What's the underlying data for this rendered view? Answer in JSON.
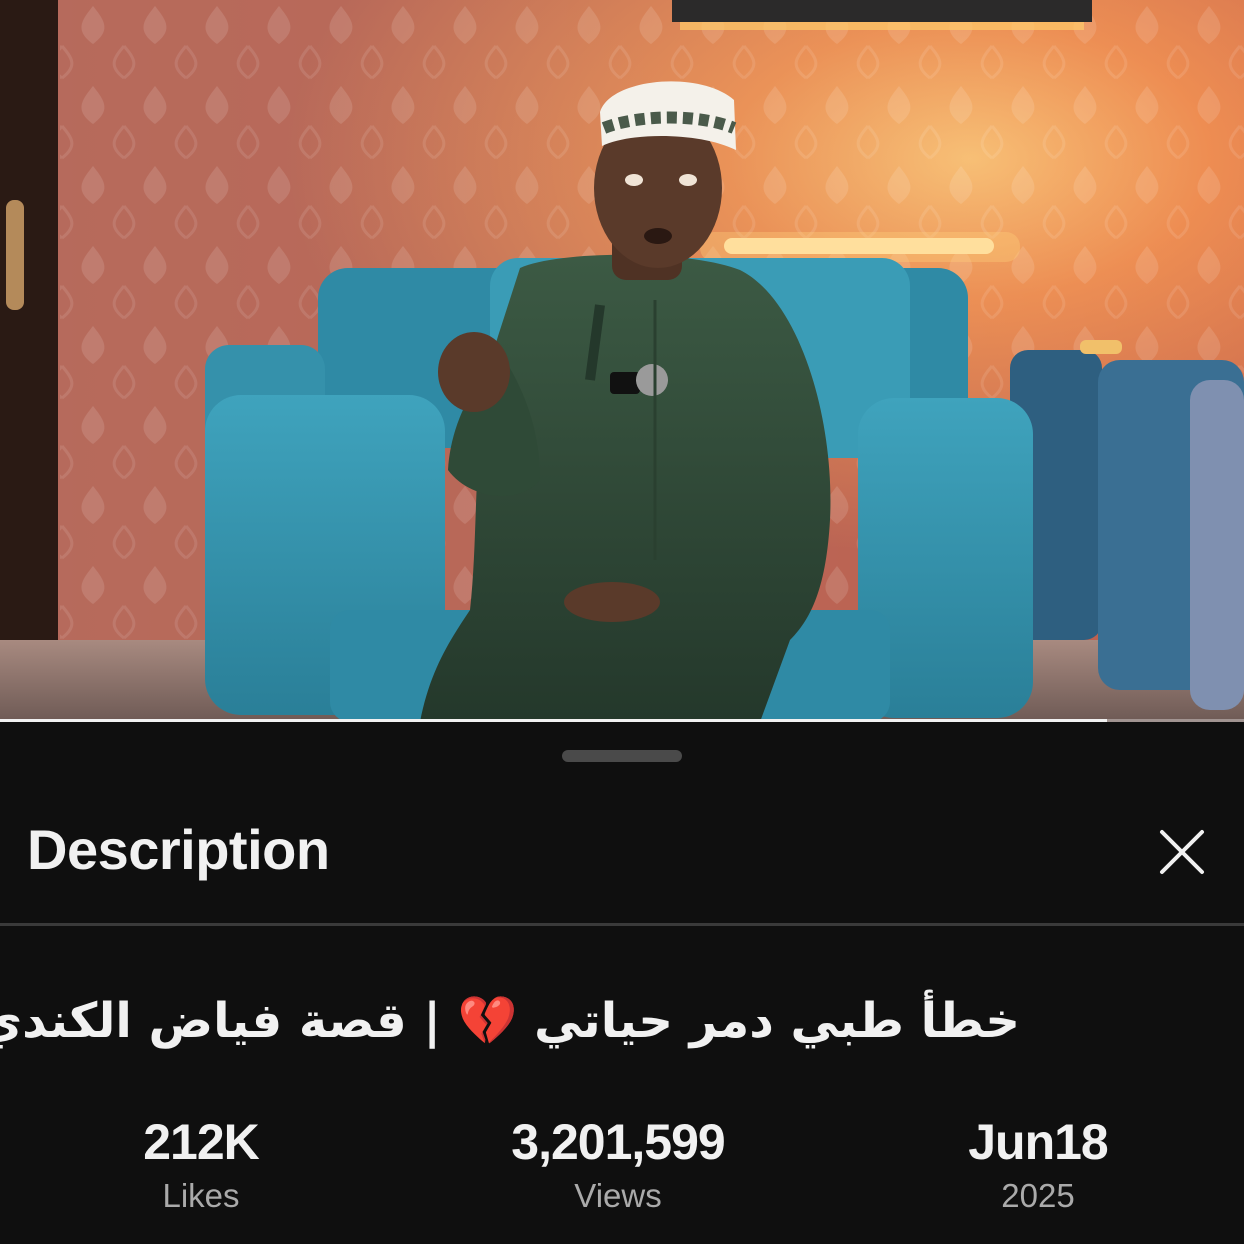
{
  "video": {
    "progress": 0.89
  },
  "description_panel": {
    "title": "Description",
    "video_title": "خطأ طبي دمر حياتي 💔 | قصة فياض الكندي",
    "stats": [
      {
        "value": "212K",
        "label": "Likes"
      },
      {
        "value": "3,201,599",
        "label": "Views"
      },
      {
        "value": "Jun18",
        "label": "2025"
      }
    ]
  },
  "icons": {
    "close": "close-icon"
  },
  "colors": {
    "background": "#0f0f0f",
    "text_primary": "#f1f1f1",
    "text_secondary": "#aaaaaa",
    "divider": "#3a3a3a"
  }
}
